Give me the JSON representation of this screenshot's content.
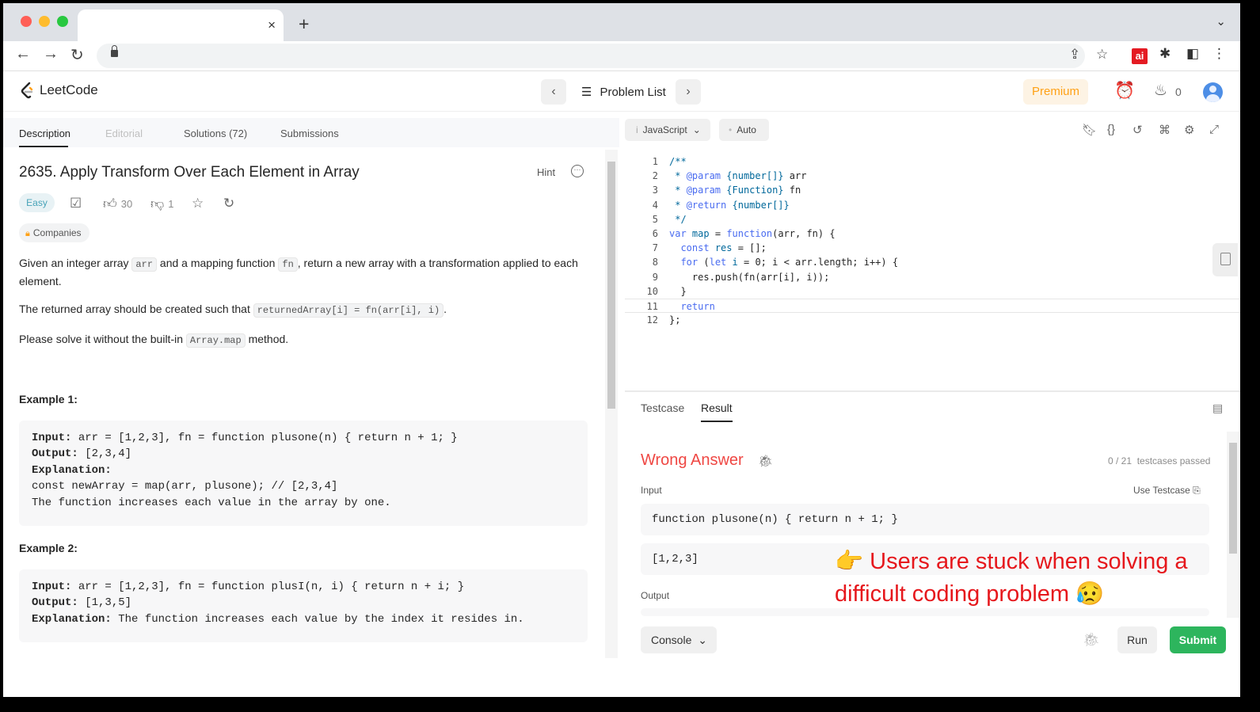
{
  "browser": {
    "dot_colors": [
      "#ff5f57",
      "#febc2e",
      "#28c840"
    ],
    "tab_close": "×",
    "new_tab": "+",
    "ext_ai": "ai"
  },
  "nav": {
    "logo": "LeetCode",
    "problem_list": "Problem List",
    "premium": "Premium",
    "streak": "0"
  },
  "left_tabs": [
    "Description",
    "Editorial",
    "Solutions (72)",
    "Submissions"
  ],
  "problem": {
    "title": "2635. Apply Transform Over Each Element in Array",
    "hint": "Hint",
    "difficulty": "Easy",
    "likes": "30",
    "dislikes": "1",
    "companies": "Companies",
    "p1a": "Given an integer array",
    "p1_code1": "arr",
    "p1b": "and a mapping function",
    "p1_code2": "fn",
    "p1c": ", return a new array with a transformation applied to each element.",
    "p2a": "The returned array should be created such that",
    "p2_code": "returnedArray[i] = fn(arr[i], i)",
    "p2b": ".",
    "p3a": "Please solve it without the built-in",
    "p3_code": "Array.map",
    "p3b": "method."
  },
  "examples": [
    {
      "heading": "Example 1:",
      "lines": [
        {
          "k": "Input:",
          "v": " arr = [1,2,3], fn = function plusone(n) { return n + 1; }"
        },
        {
          "k": "Output:",
          "v": " [2,3,4]"
        },
        {
          "k": "Explanation:",
          "v": ""
        },
        {
          "k": "",
          "v": "const newArray = map(arr, plusone); // [2,3,4]"
        },
        {
          "k": "",
          "v": "The function increases each value in the array by one."
        }
      ]
    },
    {
      "heading": "Example 2:",
      "lines": [
        {
          "k": "Input:",
          "v": " arr = [1,2,3], fn = function plusI(n, i) { return n + i; }"
        },
        {
          "k": "Output:",
          "v": " [1,3,5]"
        },
        {
          "k": "Explanation:",
          "v": " The function increases each value by the index it resides in."
        }
      ]
    }
  ],
  "editor": {
    "language": "JavaScript",
    "mode": "Auto",
    "lines": [
      {
        "n": "1",
        "html": "<span class=\"cm\">/**</span>"
      },
      {
        "n": "2",
        "html": "<span class=\"cm\"> * </span><span class=\"kw\">@param</span><span class=\"cm\"> {number[]} </span><span class=\"dk\">arr</span>"
      },
      {
        "n": "3",
        "html": "<span class=\"cm\"> * </span><span class=\"kw\">@param</span><span class=\"cm\"> {Function} </span><span class=\"dk\">fn</span>"
      },
      {
        "n": "4",
        "html": "<span class=\"cm\"> * </span><span class=\"kw\">@return</span><span class=\"cm\"> {number[]}</span>"
      },
      {
        "n": "5",
        "html": "<span class=\"cm\"> */</span>"
      },
      {
        "n": "6",
        "html": "<span class=\"kw\">var</span> <span class=\"cm\">map</span> <span class=\"dk\">=</span> <span class=\"kw\">function</span><span class=\"dk\">(arr, fn) {</span>"
      },
      {
        "n": "7",
        "html": "  <span class=\"kw\">const</span> <span class=\"cm\">res</span> <span class=\"dk\">= [];</span>"
      },
      {
        "n": "8",
        "html": "  <span class=\"kw\">for</span> <span class=\"dk\">(</span><span class=\"kw\">let</span> <span class=\"cm\">i</span> <span class=\"dk\">= 0; i &lt; arr.length; i++) {</span>"
      },
      {
        "n": "9",
        "html": "    <span class=\"dk\">res.push(fn(arr[i], i));</span>"
      },
      {
        "n": "10",
        "html": "  <span class=\"dk\">}</span>"
      },
      {
        "n": "11",
        "html": "  <span class=\"kw\">return</span>"
      },
      {
        "n": "12",
        "html": "<span class=\"dk\">};</span>"
      }
    ]
  },
  "result": {
    "tabs": [
      "Testcase",
      "Result"
    ],
    "status": "Wrong Answer",
    "passed_count": "0 / 21",
    "passed_label": "testcases passed",
    "input_label": "Input",
    "use_testcase": "Use Testcase",
    "input_fn": "function plusone(n) { return n + 1; }",
    "input_arr": "[1,2,3]",
    "output_label": "Output",
    "annotation": "👉 Users are stuck when solving a difficult coding problem 😥",
    "console": "Console",
    "run": "Run",
    "submit": "Submit"
  }
}
